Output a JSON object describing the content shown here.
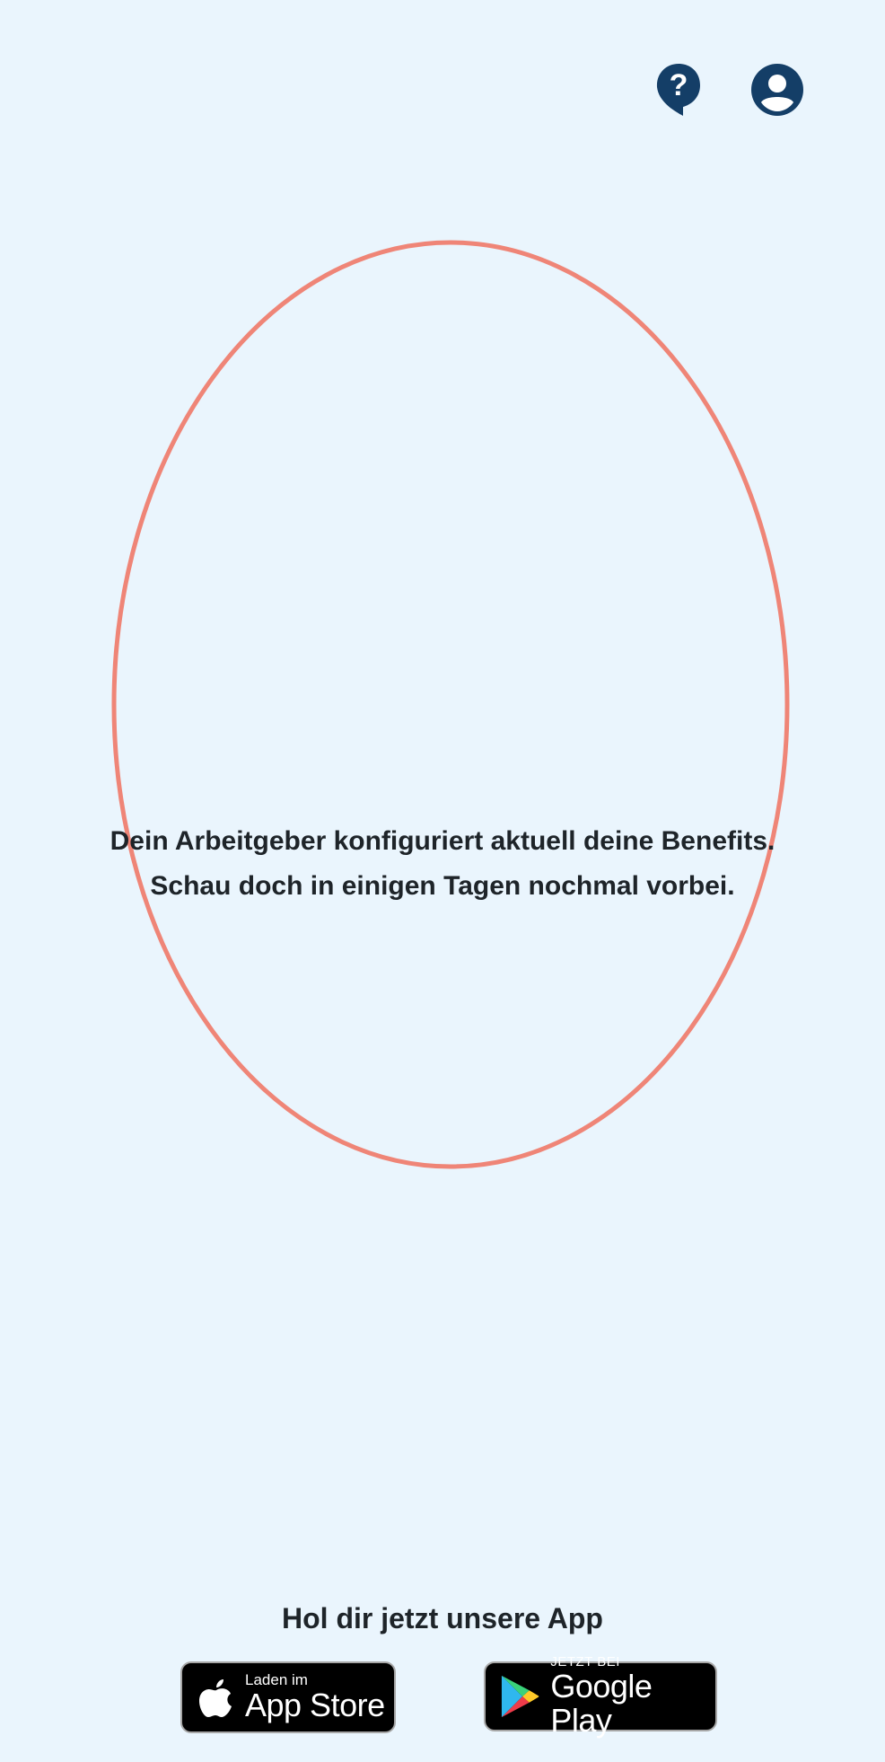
{
  "header": {
    "help_icon": "help-bubble-icon",
    "profile_icon": "user-avatar-icon"
  },
  "main": {
    "message_line1": "Dein Arbeitgeber konfiguriert aktuell deine Benefits.",
    "message_line2": "Schau doch in einigen Tagen nochmal vorbei."
  },
  "footer": {
    "app_title": "Hol dir jetzt unsere App",
    "appstore_small": "Laden im",
    "appstore_big": "App Store",
    "googleplay_small": "JETZT BEI",
    "googleplay_big": "Google Play"
  },
  "colors": {
    "background": "#eaf5fd",
    "accent_navy": "#143e67",
    "ellipse": "#ef8577",
    "text": "#1e2429"
  }
}
